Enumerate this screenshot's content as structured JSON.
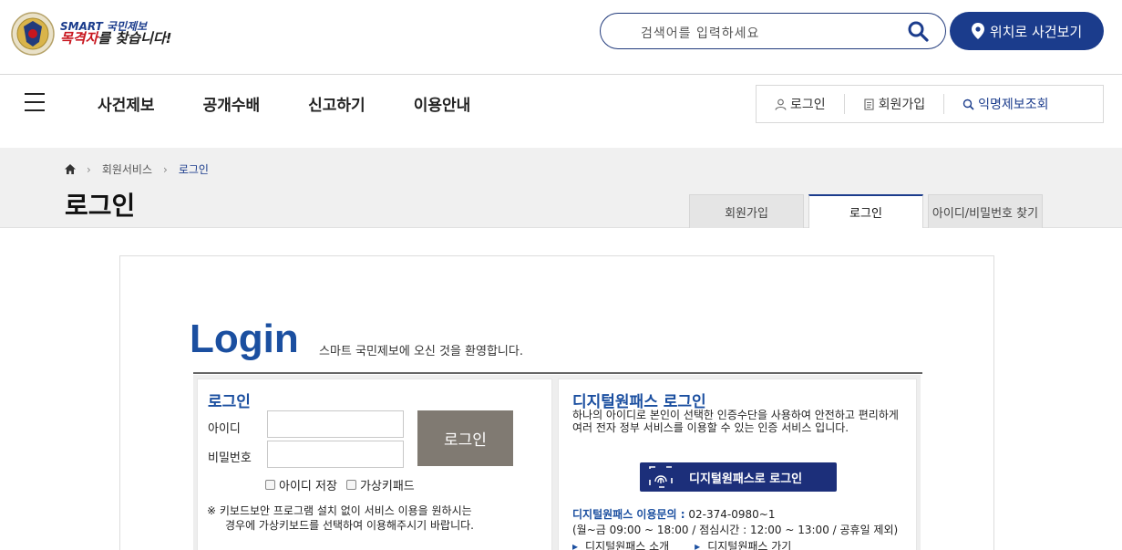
{
  "header": {
    "logo_line1": "SMART 국민제보",
    "logo_line2_red": "목격자",
    "logo_line2_rest": "를 찾습니다!",
    "search_placeholder": "검색어를 입력하세요",
    "location_button": "위치로 사건보기",
    "brand_color": "#1b3c8c"
  },
  "nav": {
    "menu": [
      "사건제보",
      "공개수배",
      "신고하기",
      "이용안내"
    ],
    "user_links": [
      {
        "label": "로그인",
        "icon": "person-icon"
      },
      {
        "label": "회원가입",
        "icon": "document-icon"
      },
      {
        "label": "익명제보조회",
        "icon": "search-icon"
      }
    ]
  },
  "breadcrumb": {
    "home_icon": "home-icon",
    "items": [
      "회원서비스",
      "로그인"
    ]
  },
  "page_title": "로그인",
  "tabs": [
    {
      "label": "회원가입",
      "active": false
    },
    {
      "label": "로그인",
      "active": true
    },
    {
      "label": "아이디/비밀번호 찾기",
      "active": false
    }
  ],
  "login": {
    "heading": "Login",
    "welcome": "스마트 국민제보에 오신 것을 환영합니다.",
    "box_title": "로그인",
    "id_label": "아이디",
    "id_value": "",
    "pw_label": "비밀번호",
    "pw_value": "",
    "submit_label": "로그인",
    "save_id_label": "아이디 저장",
    "virtual_keypad_label": "가상키패드",
    "note_line1": "※ 키보드보안 프로그램 설치 없이 서비스 이용을 원하시는",
    "note_line2": "경우에 가상키보드를 선택하여 이용해주시기 바랍니다."
  },
  "digital": {
    "title": "디지털원패스 로그인",
    "description": "하나의 아이디로 본인이 선택한 인증수단을 사용하여 안전하고 편리하게 여러 전자 정부 서비스를 이용할 수 있는 인증 서비스 입니다.",
    "button_label": "디지털원패스로 로그인",
    "inquiry_label": "디지털원패스 이용문의 :",
    "inquiry_phone": "02-374-0980~1",
    "hours": "(월~금 09:00 ~ 18:00 / 점심시간 : 12:00 ~ 13:00 / 공휴일 제외)",
    "link_intro": "디지털원패스 소개",
    "link_go": "디지털원패스 가기"
  }
}
